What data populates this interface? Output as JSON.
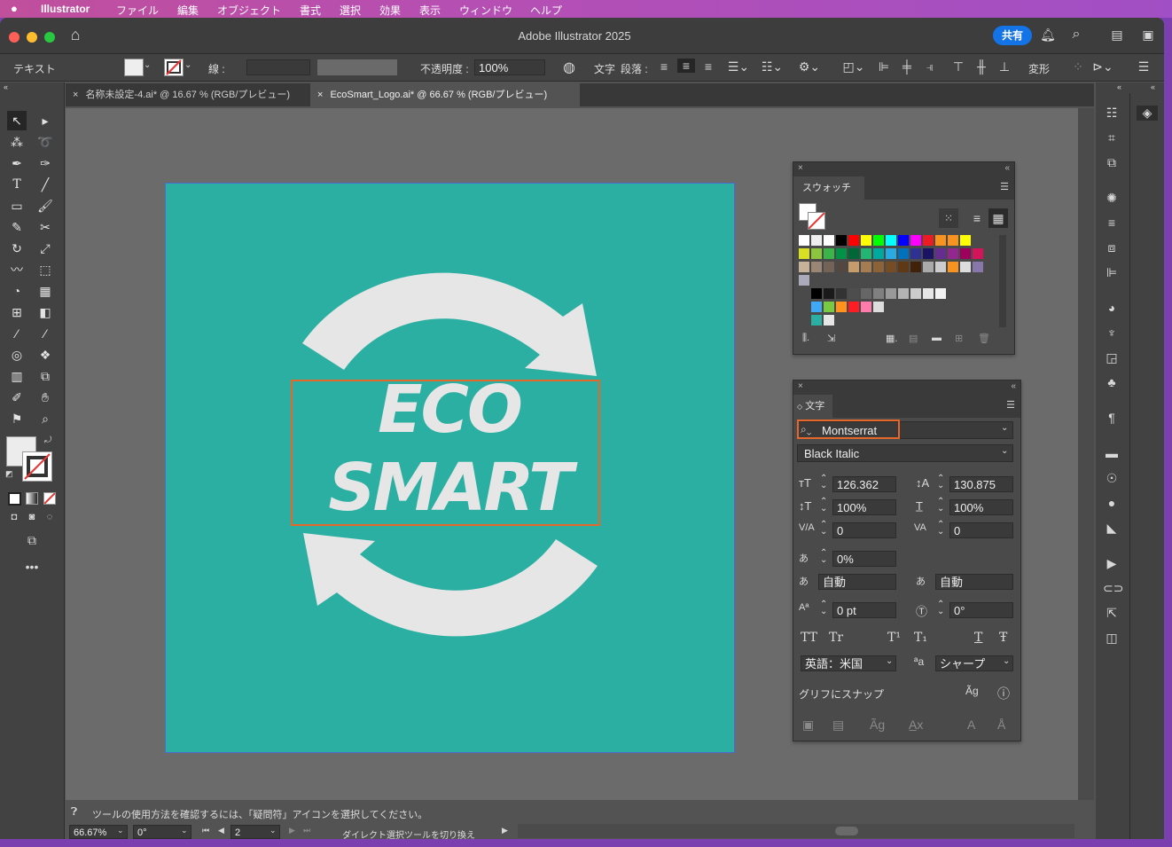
{
  "menubar": {
    "app": "Illustrator",
    "items": [
      "ファイル",
      "編集",
      "オブジェクト",
      "書式",
      "選択",
      "効果",
      "表示",
      "ウィンドウ",
      "ヘルプ"
    ]
  },
  "titlebar": {
    "title": "Adobe Illustrator 2025",
    "share_label": "共有"
  },
  "control_bar": {
    "mode_label": "テキスト",
    "stroke_label": "線 :",
    "opacity_label": "不透明度 :",
    "opacity_value": "100%",
    "char_label": "文字",
    "para_label": "段落 :",
    "transform_label": "変形"
  },
  "tabs": [
    {
      "label": "名称未設定-4.ai* @ 16.67 % (RGB/プレビュー)",
      "active": false
    },
    {
      "label": "EcoSmart_Logo.ai* @ 66.67 % (RGB/プレビュー)",
      "active": true
    }
  ],
  "artboard": {
    "line1": "ECO",
    "line2": "SMART",
    "bg_color": "#2aafa2",
    "arrow_color": "#e6e6e6"
  },
  "swatches_panel": {
    "title": "スウォッチ"
  },
  "character_panel": {
    "title": "文字",
    "font_family": "Montserrat",
    "font_style": "Black Italic",
    "font_size": "126.362",
    "leading": "130.875",
    "vertical_scale": "100%",
    "horizontal_scale": "100%",
    "kerning": "0",
    "tracking": "0",
    "tsume": "0%",
    "aki_left": "自動",
    "aki_right": "自動",
    "baseline_shift": "0 pt",
    "rotation": "0°",
    "style_buttons": [
      "TT",
      "Tr",
      "T¹",
      "T₁",
      "T",
      "Ŧ"
    ],
    "language": "英語：米国",
    "aa_label": "ªa",
    "antialias": "シャープ",
    "snap_label": "グリフにスナップ"
  },
  "status": {
    "hint": "ツールの使用方法を確認するには、「疑問符」アイコンを選択してください。",
    "zoom": "66.67%",
    "angle": "0°",
    "page": "2",
    "tool_status": "ダイレクト選択ツールを切り換え"
  }
}
